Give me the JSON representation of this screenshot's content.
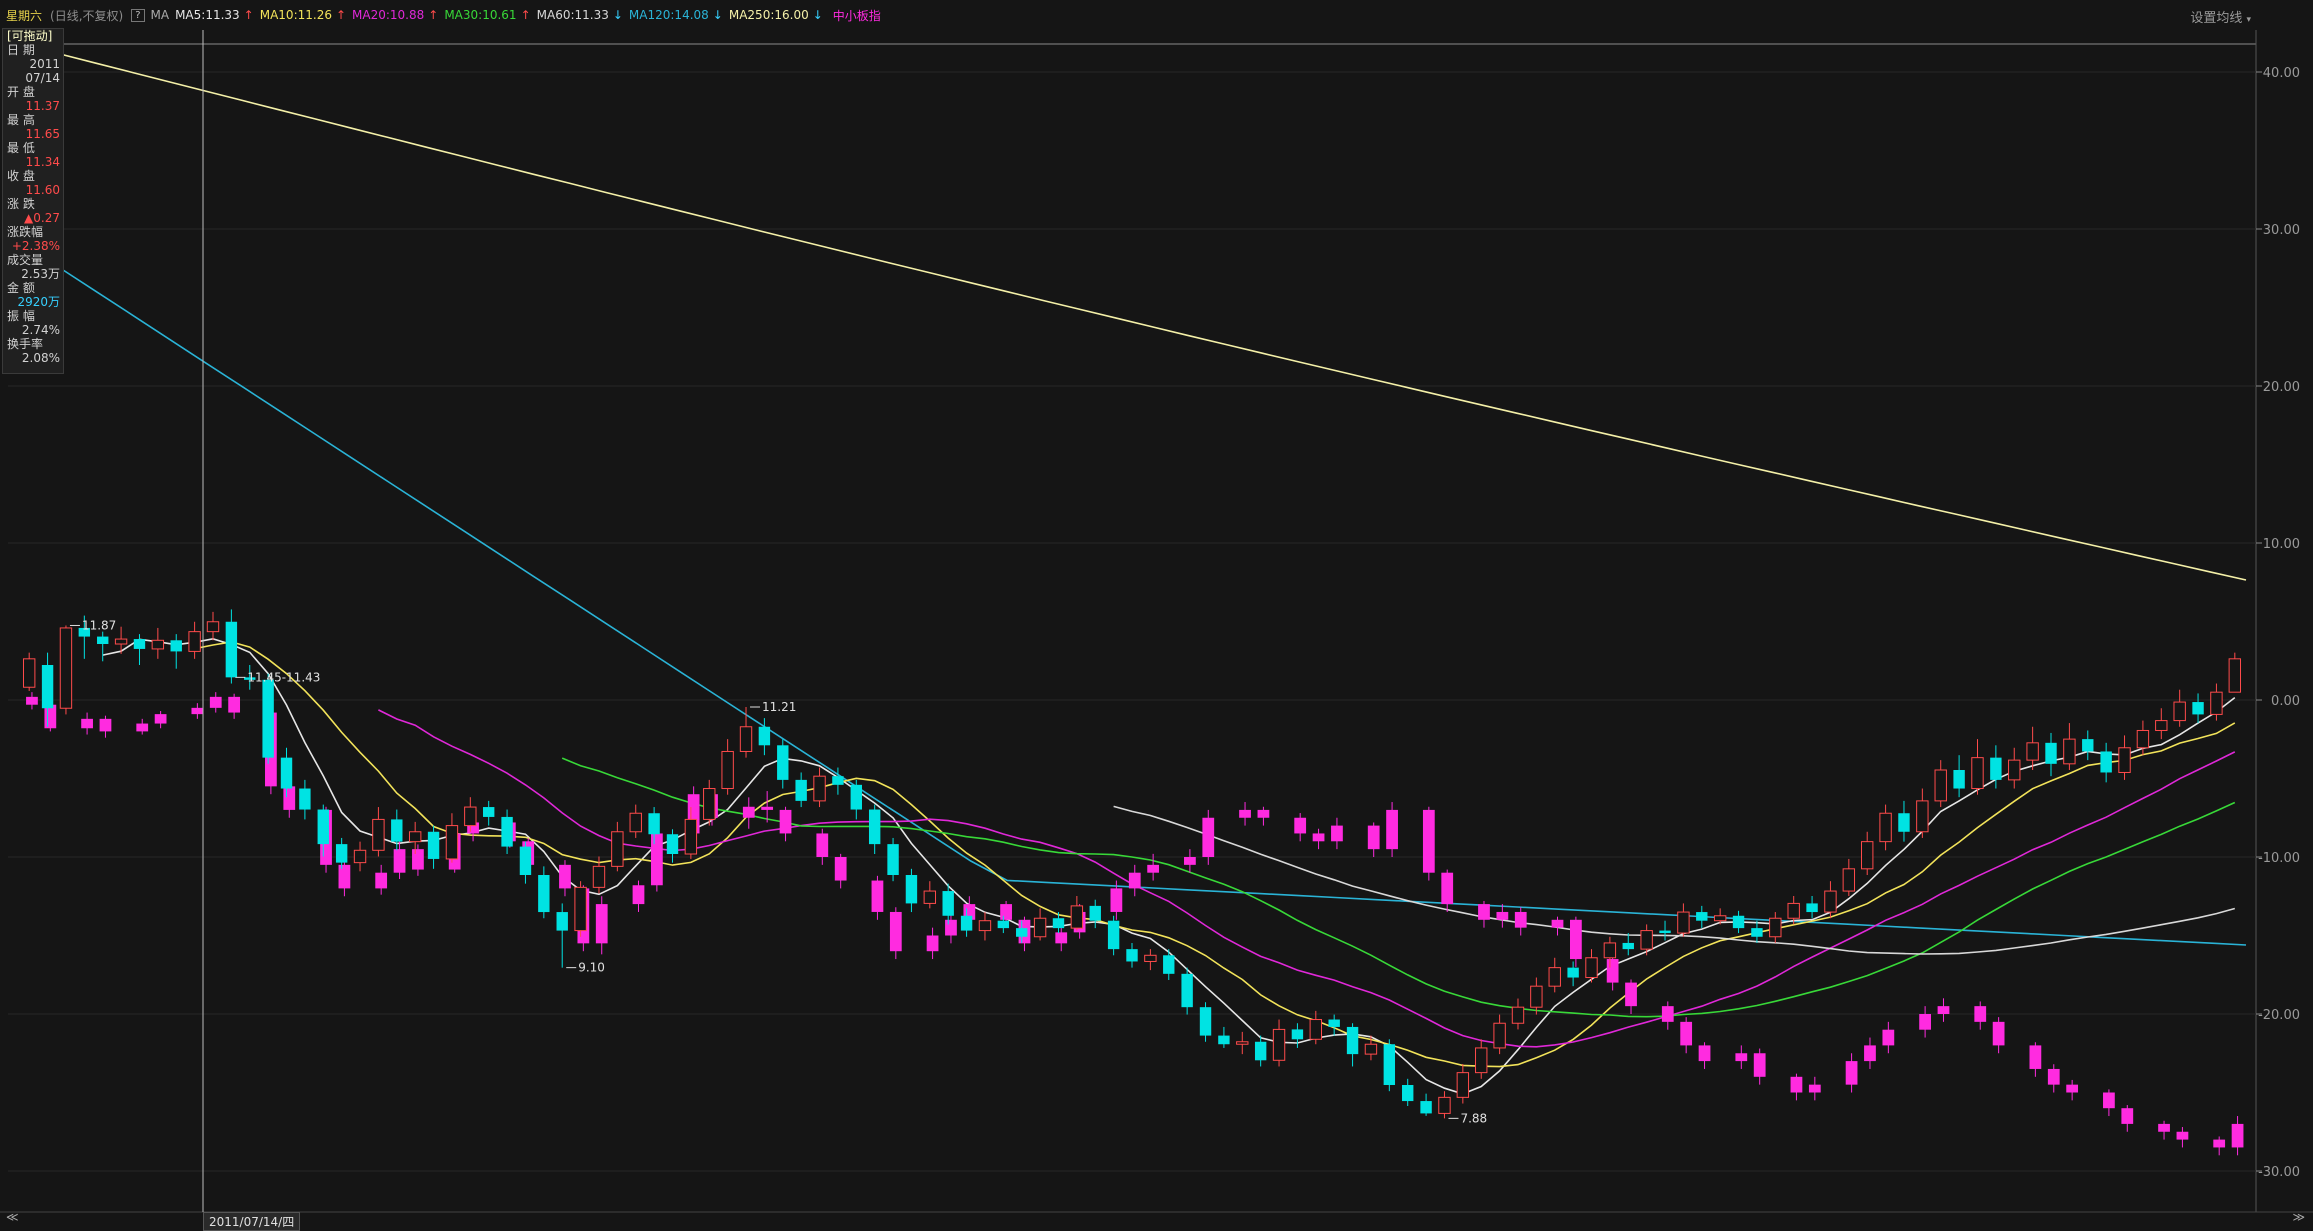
{
  "header": {
    "stock_name": "星期六",
    "sub_info": "(日线,不复权)",
    "help_label": "?",
    "ma_label": "MA",
    "ma_items": [
      {
        "text": "MA5:11.33",
        "color": "#e6e6e6",
        "trend": "up"
      },
      {
        "text": "MA10:11.26",
        "color": "#f2e35a",
        "trend": "up"
      },
      {
        "text": "MA20:10.88",
        "color": "#e028d8",
        "trend": "up"
      },
      {
        "text": "MA30:10.61",
        "color": "#38d838",
        "trend": "up"
      },
      {
        "text": "MA60:11.33",
        "color": "#d8d8d8",
        "trend": "down"
      },
      {
        "text": "MA120:14.08",
        "color": "#2ab3d6",
        "trend": "down"
      },
      {
        "text": "MA250:16.00",
        "color": "#f4f0a8",
        "trend": "down"
      }
    ],
    "index_label": "中小板指",
    "settings_label": "设置均线"
  },
  "info_panel": {
    "draggable_label": "[可拖动]",
    "rows": [
      {
        "label": "日  期",
        "value": "2011",
        "color": "#d2d2d2"
      },
      {
        "label": "",
        "value": "07/14",
        "color": "#d2d2d2"
      },
      {
        "label": "开  盘",
        "value": "11.37",
        "color": "#ff4b4b"
      },
      {
        "label": "最  高",
        "value": "11.65",
        "color": "#ff4b4b"
      },
      {
        "label": "最  低",
        "value": "11.34",
        "color": "#ff4b4b"
      },
      {
        "label": "收  盘",
        "value": "11.60",
        "color": "#ff4b4b"
      },
      {
        "label": "涨  跌",
        "value": "▲0.27",
        "color": "#ff4b4b"
      },
      {
        "label": "涨跌幅",
        "value": "+2.38%",
        "color": "#ff4b4b"
      },
      {
        "label": "成交量",
        "value": "2.53万",
        "color": "#d2d2d2"
      },
      {
        "label": "金  额",
        "value": "2920万",
        "color": "#36d0ff"
      },
      {
        "label": "振  幅",
        "value": "2.74%",
        "color": "#d2d2d2"
      },
      {
        "label": "换手率",
        "value": "2.08%",
        "color": "#d2d2d2"
      }
    ]
  },
  "footer": {
    "date_marker": "2011/07/14/四",
    "prev_label": "≪",
    "next_label": "≫"
  },
  "chart_data": {
    "type": "candlestick",
    "y_axis_ticks": [
      "40.00",
      "30.00",
      "20.00",
      "10.00",
      "0.00",
      "-10.00",
      "-20.00",
      "-30.00"
    ],
    "annotations": [
      {
        "text": "11.87",
        "index": 2,
        "value": 11.87
      },
      {
        "text": "11.45-11.43",
        "index": 11,
        "value": 11.45
      },
      {
        "text": "9.10",
        "index": 29,
        "value": 9.1
      },
      {
        "text": "11.21",
        "index": 39,
        "value": 11.21
      },
      {
        "text": "7.88",
        "index": 77,
        "value": 7.88
      }
    ],
    "colors": {
      "up": "#ff4b4b",
      "down": "#00e3e3",
      "index": "#ff2be0"
    },
    "candles": [
      [
        11.37,
        11.6,
        11.65,
        11.34
      ],
      [
        11.55,
        11.2,
        11.65,
        11.05
      ],
      [
        11.2,
        11.85,
        11.87,
        11.15
      ],
      [
        11.85,
        11.78,
        11.95,
        11.6
      ],
      [
        11.78,
        11.72,
        11.82,
        11.58
      ],
      [
        11.72,
        11.76,
        11.86,
        11.64
      ],
      [
        11.76,
        11.68,
        11.8,
        11.55
      ],
      [
        11.68,
        11.75,
        11.85,
        11.6
      ],
      [
        11.75,
        11.66,
        11.8,
        11.52
      ],
      [
        11.66,
        11.82,
        11.9,
        11.6
      ],
      [
        11.82,
        11.9,
        11.98,
        11.75
      ],
      [
        11.9,
        11.45,
        12.0,
        11.4
      ],
      [
        11.45,
        11.43,
        11.55,
        11.35
      ],
      [
        11.43,
        10.8,
        11.48,
        10.75
      ],
      [
        10.8,
        10.55,
        10.88,
        10.48
      ],
      [
        10.55,
        10.38,
        10.62,
        10.3
      ],
      [
        10.38,
        10.1,
        10.42,
        10.0
      ],
      [
        10.1,
        9.95,
        10.15,
        9.9
      ],
      [
        9.95,
        10.05,
        10.12,
        9.88
      ],
      [
        10.05,
        10.3,
        10.4,
        10.0
      ],
      [
        10.3,
        10.12,
        10.38,
        10.05
      ],
      [
        10.12,
        10.2,
        10.28,
        10.02
      ],
      [
        10.2,
        9.98,
        10.25,
        9.9
      ],
      [
        9.98,
        10.25,
        10.35,
        9.95
      ],
      [
        10.25,
        10.4,
        10.48,
        10.2
      ],
      [
        10.4,
        10.32,
        10.45,
        10.25
      ],
      [
        10.32,
        10.08,
        10.38,
        10.02
      ],
      [
        10.08,
        9.85,
        10.12,
        9.78
      ],
      [
        9.85,
        9.55,
        9.92,
        9.5
      ],
      [
        9.55,
        9.4,
        9.62,
        9.1
      ],
      [
        9.4,
        9.75,
        9.8,
        9.35
      ],
      [
        9.75,
        9.92,
        10.0,
        9.7
      ],
      [
        9.92,
        10.2,
        10.28,
        9.88
      ],
      [
        10.2,
        10.35,
        10.42,
        10.15
      ],
      [
        10.35,
        10.18,
        10.4,
        10.1
      ],
      [
        10.18,
        10.02,
        10.22,
        9.95
      ],
      [
        10.02,
        10.3,
        10.4,
        9.98
      ],
      [
        10.3,
        10.55,
        10.62,
        10.25
      ],
      [
        10.55,
        10.85,
        10.95,
        10.5
      ],
      [
        10.85,
        11.05,
        11.21,
        10.8
      ],
      [
        11.05,
        10.9,
        11.12,
        10.82
      ],
      [
        10.9,
        10.62,
        10.95,
        10.55
      ],
      [
        10.62,
        10.45,
        10.68,
        10.4
      ],
      [
        10.45,
        10.65,
        10.72,
        10.4
      ],
      [
        10.65,
        10.58,
        10.72,
        10.5
      ],
      [
        10.58,
        10.38,
        10.62,
        10.3
      ],
      [
        10.38,
        10.1,
        10.42,
        10.02
      ],
      [
        10.1,
        9.85,
        10.15,
        9.8
      ],
      [
        9.85,
        9.62,
        9.9,
        9.55
      ],
      [
        9.62,
        9.72,
        9.8,
        9.58
      ],
      [
        9.72,
        9.52,
        9.78,
        9.45
      ],
      [
        9.52,
        9.4,
        9.58,
        9.35
      ],
      [
        9.4,
        9.48,
        9.55,
        9.32
      ],
      [
        9.48,
        9.42,
        9.52,
        9.38
      ],
      [
        9.42,
        9.35,
        9.48,
        9.3
      ],
      [
        9.35,
        9.5,
        9.58,
        9.32
      ],
      [
        9.5,
        9.42,
        9.55,
        9.38
      ],
      [
        9.42,
        9.6,
        9.68,
        9.4
      ],
      [
        9.6,
        9.48,
        9.65,
        9.42
      ],
      [
        9.48,
        9.25,
        9.52,
        9.2
      ],
      [
        9.25,
        9.15,
        9.3,
        9.1
      ],
      [
        9.15,
        9.2,
        9.25,
        9.08
      ],
      [
        9.2,
        9.05,
        9.25,
        9.0
      ],
      [
        9.05,
        8.78,
        9.1,
        8.72
      ],
      [
        8.78,
        8.55,
        8.82,
        8.5
      ],
      [
        8.55,
        8.48,
        8.62,
        8.45
      ],
      [
        8.48,
        8.5,
        8.58,
        8.4
      ],
      [
        8.5,
        8.35,
        8.55,
        8.3
      ],
      [
        8.35,
        8.6,
        8.68,
        8.3
      ],
      [
        8.6,
        8.52,
        8.65,
        8.45
      ],
      [
        8.52,
        8.68,
        8.75,
        8.48
      ],
      [
        8.68,
        8.62,
        8.72,
        8.55
      ],
      [
        8.62,
        8.4,
        8.65,
        8.3
      ],
      [
        8.4,
        8.48,
        8.55,
        8.35
      ],
      [
        8.48,
        8.15,
        8.52,
        8.1
      ],
      [
        8.15,
        8.02,
        8.2,
        7.98
      ],
      [
        8.02,
        7.92,
        8.08,
        7.9
      ],
      [
        7.92,
        8.05,
        8.1,
        7.88
      ],
      [
        8.05,
        8.25,
        8.32,
        8.0
      ],
      [
        8.25,
        8.45,
        8.52,
        8.2
      ],
      [
        8.45,
        8.65,
        8.72,
        8.4
      ],
      [
        8.65,
        8.78,
        8.85,
        8.6
      ],
      [
        8.78,
        8.95,
        9.02,
        8.72
      ],
      [
        8.95,
        9.1,
        9.18,
        8.9
      ],
      [
        9.1,
        9.02,
        9.15,
        8.95
      ],
      [
        9.02,
        9.18,
        9.25,
        8.98
      ],
      [
        9.18,
        9.3,
        9.35,
        9.1
      ],
      [
        9.3,
        9.25,
        9.38,
        9.2
      ],
      [
        9.25,
        9.4,
        9.45,
        9.2
      ],
      [
        9.4,
        9.38,
        9.48,
        9.32
      ],
      [
        9.38,
        9.55,
        9.62,
        9.35
      ],
      [
        9.55,
        9.48,
        9.6,
        9.42
      ],
      [
        9.48,
        9.52,
        9.58,
        9.45
      ],
      [
        9.52,
        9.42,
        9.56,
        9.38
      ],
      [
        9.42,
        9.35,
        9.48,
        9.3
      ],
      [
        9.35,
        9.5,
        9.55,
        9.3
      ],
      [
        9.5,
        9.62,
        9.68,
        9.45
      ],
      [
        9.62,
        9.55,
        9.68,
        9.5
      ],
      [
        9.55,
        9.72,
        9.8,
        9.5
      ],
      [
        9.72,
        9.9,
        9.98,
        9.68
      ],
      [
        9.9,
        10.12,
        10.2,
        9.85
      ],
      [
        10.12,
        10.35,
        10.42,
        10.05
      ],
      [
        10.35,
        10.2,
        10.45,
        10.12
      ],
      [
        10.2,
        10.45,
        10.55,
        10.15
      ],
      [
        10.45,
        10.7,
        10.78,
        10.4
      ],
      [
        10.7,
        10.55,
        10.82,
        10.48
      ],
      [
        10.55,
        10.8,
        10.95,
        10.5
      ],
      [
        10.8,
        10.62,
        10.9,
        10.55
      ],
      [
        10.62,
        10.78,
        10.88,
        10.55
      ],
      [
        10.78,
        10.92,
        11.05,
        10.7
      ],
      [
        10.92,
        10.75,
        11.0,
        10.65
      ],
      [
        10.75,
        10.95,
        11.08,
        10.7
      ],
      [
        10.95,
        10.85,
        11.02,
        10.78
      ],
      [
        10.85,
        10.68,
        10.92,
        10.6
      ],
      [
        10.68,
        10.88,
        10.98,
        10.62
      ],
      [
        10.88,
        11.02,
        11.1,
        10.82
      ],
      [
        11.02,
        11.1,
        11.2,
        10.95
      ],
      [
        11.1,
        11.25,
        11.35,
        11.05
      ],
      [
        11.25,
        11.15,
        11.32,
        11.08
      ],
      [
        11.15,
        11.33,
        11.4,
        11.1
      ],
      [
        11.33,
        11.6,
        11.65,
        11.34
      ]
    ],
    "index_candles": [
      [
        0.2,
        -0.3,
        0.5,
        -0.6
      ],
      [
        -0.3,
        -1.8,
        -0.1,
        -2.0
      ],
      [
        -1.8,
        -1.2,
        -0.8,
        -2.2
      ],
      [
        -1.2,
        -2.0,
        -1.0,
        -2.4
      ],
      [
        -2.0,
        -1.5,
        -1.2,
        -2.2
      ],
      [
        -1.5,
        -0.9,
        -0.7,
        -1.8
      ],
      [
        -0.9,
        -0.5,
        -0.2,
        -1.2
      ],
      [
        -0.5,
        0.2,
        0.5,
        -0.8
      ],
      [
        0.2,
        -0.8,
        0.4,
        -1.2
      ],
      [
        -0.8,
        -5.5,
        -0.5,
        -6.0
      ],
      [
        -5.5,
        -7.0,
        -5.0,
        -7.5
      ],
      [
        -7.0,
        -10.5,
        -6.8,
        -11.0
      ],
      [
        -10.5,
        -12.0,
        -10.2,
        -12.5
      ],
      [
        -12.0,
        -11.0,
        -10.5,
        -12.4
      ],
      [
        -11.0,
        -9.5,
        -9.0,
        -11.4
      ],
      [
        -9.5,
        -10.8,
        -9.2,
        -11.2
      ],
      [
        -10.8,
        -8.5,
        -8.0,
        -11.0
      ],
      [
        -8.5,
        -7.8,
        -7.5,
        -9.0
      ],
      [
        -7.8,
        -9.0,
        -7.6,
        -9.4
      ],
      [
        -9.0,
        -10.5,
        -8.8,
        -11.0
      ],
      [
        -10.5,
        -12.0,
        -10.2,
        -12.5
      ],
      [
        -12.0,
        -15.5,
        -11.8,
        -16.0
      ],
      [
        -15.5,
        -13.0,
        -12.5,
        -16.2
      ],
      [
        -13.0,
        -11.8,
        -11.5,
        -13.5
      ],
      [
        -11.8,
        -8.5,
        -8.0,
        -12.2
      ],
      [
        -8.5,
        -6.0,
        -5.5,
        -9.0
      ],
      [
        -6.0,
        -7.5,
        -5.8,
        -8.0
      ],
      [
        -7.5,
        -6.8,
        -6.2,
        -8.2
      ],
      [
        -6.8,
        -7.0,
        -5.8,
        -7.8
      ],
      [
        -7.0,
        -8.5,
        -6.8,
        -9.0
      ],
      [
        -8.5,
        -10.0,
        -8.2,
        -10.5
      ],
      [
        -10.0,
        -11.5,
        -9.8,
        -12.0
      ],
      [
        -11.5,
        -13.5,
        -11.2,
        -14.0
      ],
      [
        -13.5,
        -16.0,
        -13.2,
        -16.5
      ],
      [
        -16.0,
        -15.0,
        -14.5,
        -16.5
      ],
      [
        -15.0,
        -14.0,
        -13.5,
        -15.5
      ],
      [
        -14.0,
        -13.0,
        -12.5,
        -14.5
      ],
      [
        -13.0,
        -14.0,
        -12.8,
        -14.5
      ],
      [
        -14.0,
        -15.5,
        -13.8,
        -16.0
      ],
      [
        -15.5,
        -14.8,
        -14.2,
        -16.0
      ],
      [
        -14.8,
        -13.5,
        -13.0,
        -15.2
      ],
      [
        -13.5,
        -12.0,
        -11.5,
        -14.0
      ],
      [
        -12.0,
        -11.0,
        -10.5,
        -12.5
      ],
      [
        -11.0,
        -10.5,
        -9.8,
        -11.5
      ],
      [
        -10.5,
        -10.0,
        -9.5,
        -11.0
      ],
      [
        -10.0,
        -7.5,
        -7.0,
        -10.5
      ],
      [
        -7.5,
        -7.0,
        -6.5,
        -8.0
      ],
      [
        -7.0,
        -7.5,
        -6.8,
        -8.0
      ],
      [
        -7.5,
        -8.5,
        -7.2,
        -9.0
      ],
      [
        -8.5,
        -9.0,
        -8.2,
        -9.5
      ],
      [
        -9.0,
        -8.0,
        -7.5,
        -9.5
      ],
      [
        -8.0,
        -9.5,
        -7.8,
        -10.0
      ],
      [
        -9.5,
        -7.0,
        -6.5,
        -10.0
      ],
      [
        -7.0,
        -11.0,
        -6.8,
        -11.5
      ],
      [
        -11.0,
        -13.0,
        -10.8,
        -13.5
      ],
      [
        -13.0,
        -14.0,
        -12.8,
        -14.5
      ],
      [
        -14.0,
        -13.5,
        -13.0,
        -14.5
      ],
      [
        -13.5,
        -14.5,
        -13.2,
        -15.0
      ],
      [
        -14.5,
        -14.0,
        -13.8,
        -15.0
      ],
      [
        -14.0,
        -16.5,
        -13.8,
        -17.0
      ],
      [
        -16.5,
        -18.0,
        -16.2,
        -18.5
      ],
      [
        -18.0,
        -19.5,
        -17.8,
        -20.0
      ],
      [
        -19.5,
        -20.5,
        -19.2,
        -21.0
      ],
      [
        -20.5,
        -22.0,
        -20.2,
        -22.5
      ],
      [
        -22.0,
        -23.0,
        -21.8,
        -23.5
      ],
      [
        -23.0,
        -22.5,
        -22.0,
        -23.5
      ],
      [
        -22.5,
        -24.0,
        -22.2,
        -24.5
      ],
      [
        -24.0,
        -25.0,
        -23.8,
        -25.5
      ],
      [
        -25.0,
        -24.5,
        -24.0,
        -25.5
      ],
      [
        -24.5,
        -23.0,
        -22.5,
        -25.0
      ],
      [
        -23.0,
        -22.0,
        -21.5,
        -23.5
      ],
      [
        -22.0,
        -21.0,
        -20.5,
        -22.5
      ],
      [
        -21.0,
        -20.0,
        -19.5,
        -21.5
      ],
      [
        -20.0,
        -19.5,
        -19.0,
        -20.5
      ],
      [
        -19.5,
        -20.5,
        -19.2,
        -21.0
      ],
      [
        -20.5,
        -22.0,
        -20.2,
        -22.5
      ],
      [
        -22.0,
        -23.5,
        -21.8,
        -24.0
      ],
      [
        -23.5,
        -24.5,
        -23.2,
        -25.0
      ],
      [
        -24.5,
        -25.0,
        -24.2,
        -25.5
      ],
      [
        -25.0,
        -26.0,
        -24.8,
        -26.5
      ],
      [
        -26.0,
        -27.0,
        -25.8,
        -27.5
      ],
      [
        -27.0,
        -27.5,
        -26.8,
        -28.0
      ],
      [
        -27.5,
        -28.0,
        -27.2,
        -28.5
      ],
      [
        -28.0,
        -28.5,
        -27.8,
        -29.0
      ],
      [
        -28.5,
        -27.0,
        -26.5,
        -29.0
      ]
    ]
  }
}
